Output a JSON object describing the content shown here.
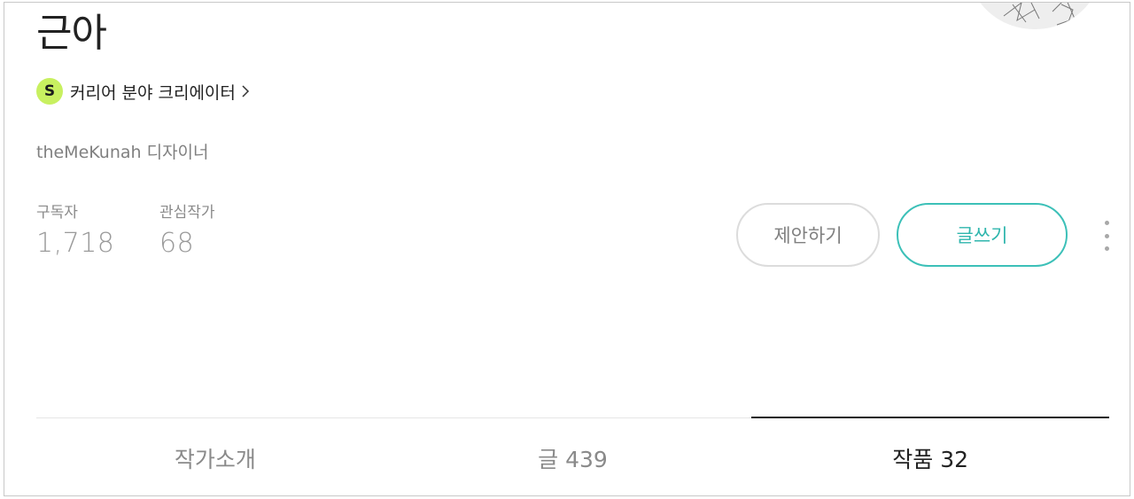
{
  "profile": {
    "name": "근아",
    "badge_letter": "S",
    "badge_text": "커리어 분야 크리에이터",
    "description": "theMeKunah 디자이너"
  },
  "stats": [
    {
      "label": "구독자",
      "value": "1,718"
    },
    {
      "label": "관심작가",
      "value": "68"
    }
  ],
  "actions": {
    "propose_label": "제안하기",
    "write_label": "글쓰기"
  },
  "tabs": [
    {
      "label": "작가소개",
      "active": false
    },
    {
      "label": "글 439",
      "active": false
    },
    {
      "label": "작품 32",
      "active": true
    }
  ],
  "colors": {
    "badge_bg": "#c8f060",
    "accent": "#3cc0b8",
    "muted_text": "#808080"
  },
  "icons": [
    "chevron-right-icon",
    "more-vertical-icon"
  ]
}
